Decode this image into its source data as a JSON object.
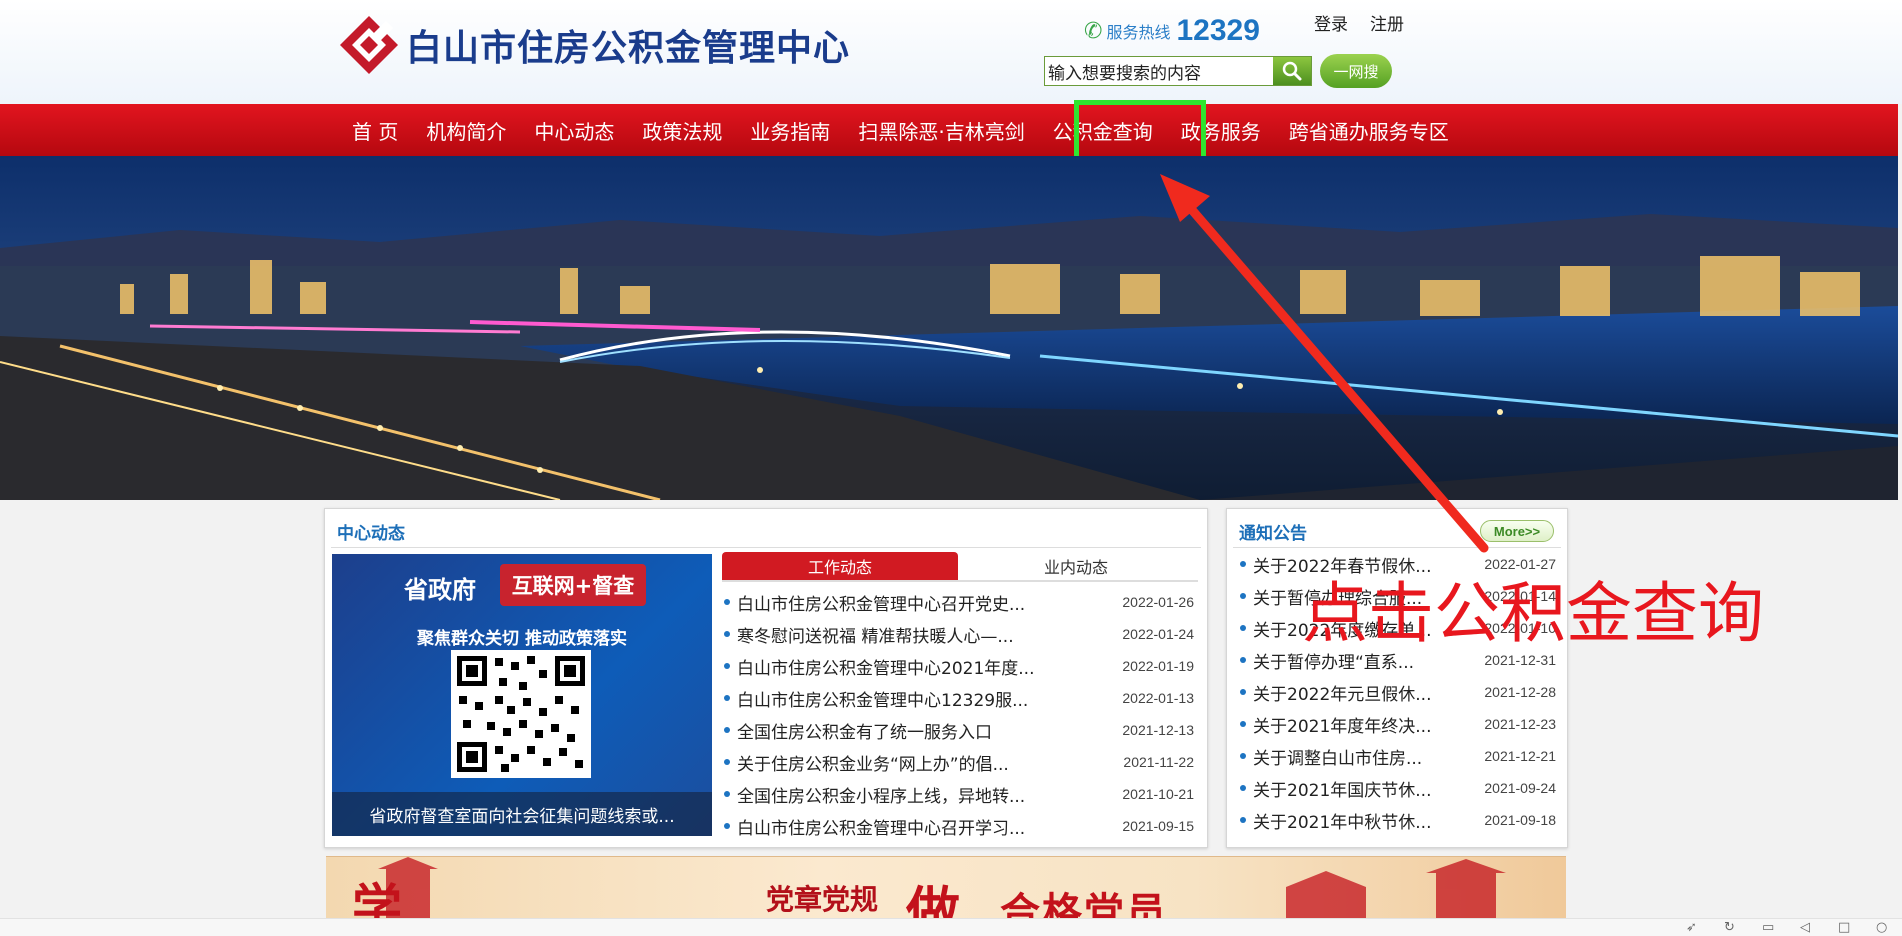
{
  "header": {
    "logo_text": "白山市住房公积金管理中心",
    "hotline_label": "服务热线",
    "hotline_number": "12329",
    "login": "登录",
    "register": "注册",
    "search_placeholder": "输入想要搜索的内容",
    "search_value": "输入想要搜索的内容",
    "search_all": "一网搜"
  },
  "nav": {
    "items": [
      "首  页",
      "机构简介",
      "中心动态",
      "政策法规",
      "业务指南",
      "扫黑除恶·吉林亮剑",
      "公积金查询",
      "政务服务",
      "跨省通办服务专区"
    ]
  },
  "center_news": {
    "title": "中心动态",
    "promo": {
      "title": "省政府",
      "badge": "互联网+督查",
      "subtitle": "聚焦群众关切 推动政策落实",
      "caption": "省政府督查室面向社会征集问题线索或..."
    },
    "tabs": [
      "工作动态",
      "业内动态"
    ],
    "items": [
      {
        "title": "白山市住房公积金管理中心召开党史...",
        "date": "2022-01-26"
      },
      {
        "title": "寒冬慰问送祝福 精准帮扶暖人心—...",
        "date": "2022-01-24"
      },
      {
        "title": "白山市住房公积金管理中心2021年度...",
        "date": "2022-01-19"
      },
      {
        "title": "白山市住房公积金管理中心12329服...",
        "date": "2022-01-13"
      },
      {
        "title": "全国住房公积金有了统一服务入口",
        "date": "2021-12-13"
      },
      {
        "title": "关于住房公积金业务“网上办”的倡...",
        "date": "2021-11-22"
      },
      {
        "title": "全国住房公积金小程序上线，异地转...",
        "date": "2021-10-21"
      },
      {
        "title": "白山市住房公积金管理中心召开学习...",
        "date": "2021-09-15"
      }
    ]
  },
  "notice": {
    "title": "通知公告",
    "more": "More>>",
    "items": [
      {
        "title": "关于2022年春节假休...",
        "date": "2022-01-27"
      },
      {
        "title": "关于暂停办理综合服...",
        "date": "2022-01-14"
      },
      {
        "title": "关于2022年度缴存单...",
        "date": "2022-01-10"
      },
      {
        "title": "关于暂停办理“直系...",
        "date": "2021-12-31"
      },
      {
        "title": "关于2022年元旦假休...",
        "date": "2021-12-28"
      },
      {
        "title": "关于2021年度年终决...",
        "date": "2021-12-23"
      },
      {
        "title": "关于调整白山市住房...",
        "date": "2021-12-21"
      },
      {
        "title": "关于2021年国庆节休...",
        "date": "2021-09-24"
      },
      {
        "title": "关于2021年中秋节休...",
        "date": "2021-09-18"
      }
    ]
  },
  "ribbon": {
    "char1": "学",
    "text1": "党章党规",
    "char2": "做",
    "text2": "合格党员"
  },
  "annotation": {
    "text": "点击公积金查询",
    "color": "#e8171e",
    "highlight_color": "#2fe52f"
  },
  "colors": {
    "nav_red": "#d11a22",
    "title_blue": "#1d6fb8",
    "hotline_blue": "#1d74c2"
  }
}
